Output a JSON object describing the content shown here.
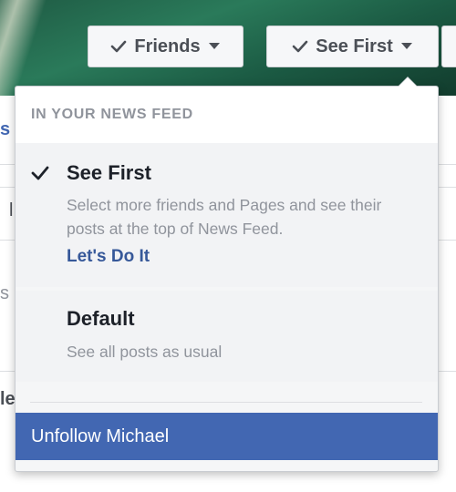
{
  "header": {
    "friends_label": "Friends",
    "see_first_label": "See First"
  },
  "background": {
    "frag1": "s",
    "frag2": "l",
    "frag3": "s",
    "frag4": "le"
  },
  "menu": {
    "section_title": "IN YOUR NEWS FEED",
    "options": [
      {
        "title": "See First",
        "description": "Select more friends and Pages and see their posts at the top of News Feed.",
        "link": "Let's Do It",
        "selected": true
      },
      {
        "title": "Default",
        "description": "See all posts as usual",
        "selected": false
      }
    ],
    "unfollow_label": "Unfollow Michael"
  },
  "colors": {
    "accent": "#4267b2",
    "link": "#365899",
    "muted": "#90949c"
  }
}
